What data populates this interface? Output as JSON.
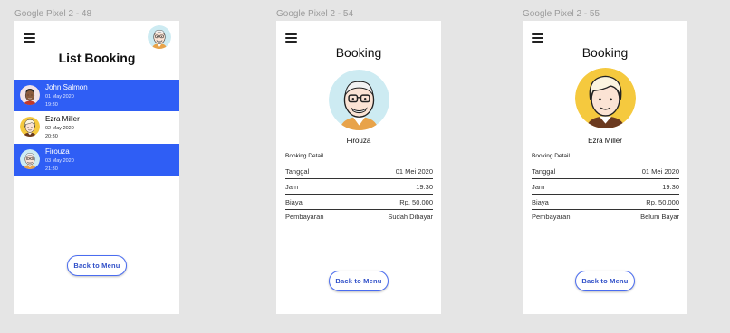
{
  "frames": [
    {
      "label": "Google Pixel 2 - 48",
      "title": "List Booking",
      "bookings": [
        {
          "name": "John Salmon",
          "date": "01 May 2020",
          "time": "19:30",
          "selected": true,
          "avatar": "dark"
        },
        {
          "name": "Ezra Miller",
          "date": "02 May 2020",
          "time": "20:30",
          "selected": false,
          "avatar": "yellow"
        },
        {
          "name": "Firouza",
          "date": "03 May 2020",
          "time": "21:30",
          "selected": true,
          "avatar": "cyan"
        }
      ],
      "back_label": "Back to Menu"
    },
    {
      "label": "Google Pixel 2 - 54",
      "title": "Booking",
      "name": "Firouza",
      "detail_heading": "Booking Detail",
      "rows": [
        {
          "label": "Tanggal",
          "value": "01 Mei 2020"
        },
        {
          "label": "Jam",
          "value": "19:30"
        },
        {
          "label": "Biaya",
          "value": "Rp. 50.000"
        },
        {
          "label": "Pembayaran",
          "value": "Sudah Dibayar"
        }
      ],
      "back_label": "Back to Menu"
    },
    {
      "label": "Google Pixel 2 - 55",
      "title": "Booking",
      "name": "Ezra Miller",
      "detail_heading": "Booking Detail",
      "rows": [
        {
          "label": "Tanggal",
          "value": "01 Mei 2020"
        },
        {
          "label": "Jam",
          "value": "19:30"
        },
        {
          "label": "Biaya",
          "value": "Rp. 50.000"
        },
        {
          "label": "Pembayaran",
          "value": "Belum Bayar"
        }
      ],
      "back_label": "Back to Menu"
    }
  ],
  "colors": {
    "accent": "#2f5ef5",
    "avatar_cyan": "#cdebf2",
    "avatar_yellow": "#f5c93e"
  }
}
